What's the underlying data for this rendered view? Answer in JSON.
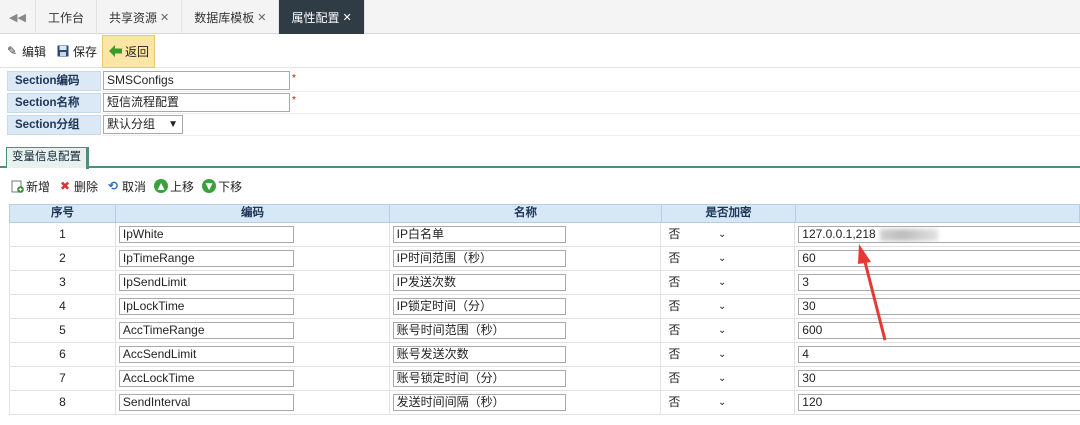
{
  "tabbar": {
    "nav_icon": "double-chevron-left-icon",
    "tabs": [
      {
        "label": "工作台",
        "closable": false
      },
      {
        "label": "共享资源",
        "closable": true
      },
      {
        "label": "数据库模板",
        "closable": true
      },
      {
        "label": "属性配置",
        "closable": true,
        "active": true
      }
    ]
  },
  "toolbar": {
    "edit_label": "编辑",
    "save_label": "保存",
    "back_label": "返回"
  },
  "form": {
    "code_label": "Section编码",
    "code_value": "SMSConfigs",
    "name_label": "Section名称",
    "name_value": "短信流程配置",
    "group_label": "Section分组",
    "group_value": "默认分组",
    "required_mark": "*"
  },
  "section_tab": "变量信息配置",
  "grid_toolbar": {
    "add_label": "新增",
    "delete_label": "删除",
    "cancel_label": "取消",
    "up_label": "上移",
    "down_label": "下移"
  },
  "grid": {
    "headers": [
      "序号",
      "编码",
      "名称",
      "是否加密",
      ""
    ],
    "rows": [
      {
        "idx": "1",
        "code": "IpWhite",
        "name": "IP白名单",
        "enc": "否",
        "value": "127.0.0.1,218"
      },
      {
        "idx": "2",
        "code": "IpTimeRange",
        "name": "IP时间范围（秒）",
        "enc": "否",
        "value": "60"
      },
      {
        "idx": "3",
        "code": "IpSendLimit",
        "name": "IP发送次数",
        "enc": "否",
        "value": "3"
      },
      {
        "idx": "4",
        "code": "IpLockTime",
        "name": "IP锁定时间（分）",
        "enc": "否",
        "value": "30"
      },
      {
        "idx": "5",
        "code": "AccTimeRange",
        "name": "账号时间范围（秒）",
        "enc": "否",
        "value": "600"
      },
      {
        "idx": "6",
        "code": "AccSendLimit",
        "name": "账号发送次数",
        "enc": "否",
        "value": "4"
      },
      {
        "idx": "7",
        "code": "AccLockTime",
        "name": "账号锁定时间（分）",
        "enc": "否",
        "value": "30"
      },
      {
        "idx": "8",
        "code": "SendInterval",
        "name": "发送时间间隔（秒）",
        "enc": "否",
        "value": "120"
      }
    ]
  },
  "colors": {
    "active_tab": "#2f3b45",
    "label_bg": "#dbe9f7",
    "section_border": "#4f8e7e",
    "annotation_arrow": "#e53935"
  }
}
